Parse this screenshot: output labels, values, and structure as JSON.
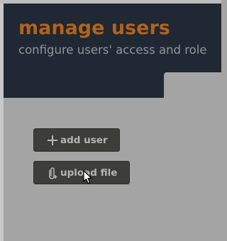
{
  "header": {
    "title": "manage users",
    "subtitle": "configure users' access and role"
  },
  "actions": {
    "add_user_label": "add user",
    "add_user_icon": "plus-icon",
    "upload_file_label": "upload file",
    "upload_file_icon": "paperclip-plus-icon"
  },
  "colors": {
    "header_bg": "#1f2833",
    "title": "#b4621a",
    "subtitle": "#8f969b",
    "content_bg": "#a4a4a4",
    "button_bg": "#3d3d3b",
    "button_text": "#b5b5b5"
  }
}
